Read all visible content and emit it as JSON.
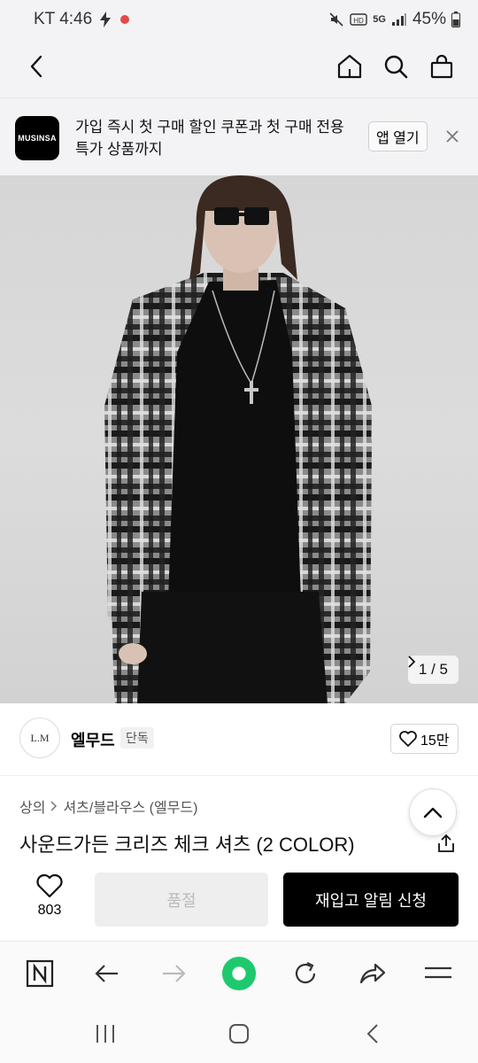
{
  "status_bar": {
    "carrier_time": "KT 4:46",
    "battery": "45%",
    "network": "5G"
  },
  "top_nav": {
    "back_icon": "chevron-left-icon",
    "home_icon": "home-icon",
    "search_icon": "search-icon",
    "bag_icon": "shopping-bag-icon"
  },
  "promo": {
    "logo_text": "MUSINSA",
    "text": "가입 즉시 첫 구매 할인 쿠폰과 첫 구매 전용 특가 상품까지",
    "open_label": "앱 열기"
  },
  "hero": {
    "counter": "1 / 5"
  },
  "brand": {
    "logo_text": "L.M",
    "name": "엘무드",
    "badge": "단독",
    "likes": "15만"
  },
  "product": {
    "breadcrumb": [
      "상의",
      "셔츠/블라우스 (엘무드)"
    ],
    "title": "사운드가든 크리즈 체크 셔츠 (2 COLOR)"
  },
  "actions": {
    "wish_count": "803",
    "soldout_label": "품절",
    "restock_label": "재입고 알림 신청"
  },
  "colors": {
    "accent": "#000000",
    "browser_accent": "#1ec96e"
  }
}
